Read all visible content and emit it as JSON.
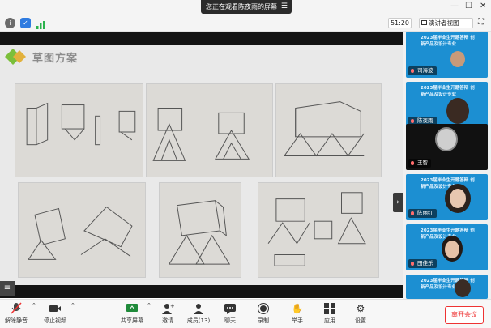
{
  "banner": {
    "text": "您正在观看陈夜雨的屏幕",
    "menu_icon": "list-icon"
  },
  "status_bar": {
    "timer": "51:20",
    "view_button": "演讲者视图"
  },
  "slide": {
    "title": "草图方案"
  },
  "participants": [
    {
      "name": "司海波",
      "tile_text": "2023届毕业生开题答辩 创新产品及设计专业",
      "muted": true
    },
    {
      "name": "陈夜雨",
      "tile_text": "2023届毕业生开题答辩 创新产品及设计专业",
      "muted": true
    },
    {
      "name": "王智",
      "tile_text": "",
      "muted": true
    },
    {
      "name": "陈丽红",
      "tile_text": "2023届毕业生开题答辩 创新产品及设计专业",
      "muted": true
    },
    {
      "name": "田佳乐",
      "tile_text": "2023届毕业生开题答辩 创新产品及设计专业",
      "muted": true
    },
    {
      "name": "",
      "tile_text": "2023届毕业生开题答辩 创新产品及设计专业",
      "muted": false
    }
  ],
  "toolbar": {
    "unmute": "解除静音",
    "stop_video": "停止视频",
    "share_screen": "共享屏幕",
    "invite": "邀请",
    "members": "成员(13)",
    "chat": "聊天",
    "record": "录制",
    "raise_hand": "举手",
    "apps": "应用",
    "settings": "设置",
    "leave": "离开会议"
  },
  "colors": {
    "tile_blue": "#1c8fd2",
    "leave_red": "#e33333",
    "logo_green": "#7bbf3a"
  }
}
